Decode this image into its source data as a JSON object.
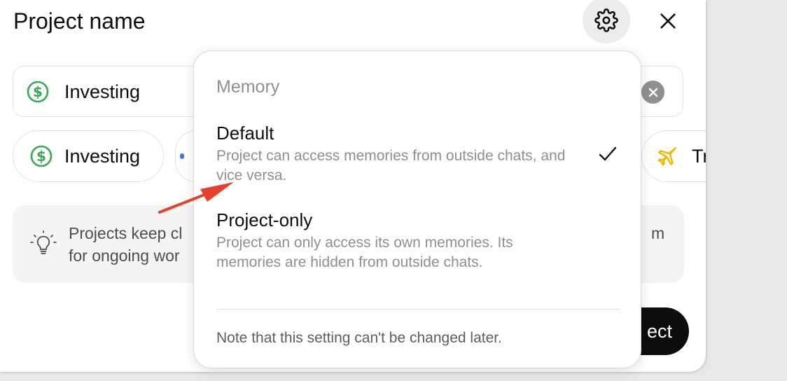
{
  "header": {
    "title": "Project name",
    "settings_icon": "gear-icon",
    "close_icon": "close-icon"
  },
  "name_field": {
    "value": "Investing",
    "icon": "dollar-circle-icon",
    "clear_icon": "clear-icon"
  },
  "suggestions": [
    {
      "label": "Investing",
      "icon": "dollar-circle-icon"
    },
    {
      "label": "",
      "icon": "partial-icon"
    },
    {
      "label": "Tr",
      "icon": "airplane-icon"
    }
  ],
  "info": {
    "line1_left": "Projects keep cl",
    "line1_right": "m",
    "line2_left": "for ongoing wor",
    "icon": "lightbulb-icon"
  },
  "create_button": {
    "label": "ect"
  },
  "memory_popover": {
    "heading": "Memory",
    "options": [
      {
        "title": "Default",
        "description": "Project can access memories from outside chats, and vice versa.",
        "selected": true
      },
      {
        "title": "Project-only",
        "description": "Project can only access its own memories. Its memories are hidden from outside chats.",
        "selected": false
      }
    ],
    "note": "Note that this setting can't be changed later."
  },
  "colors": {
    "accent_green": "#3aa757",
    "accent_yellow": "#f2b705",
    "annotation_red": "#e8412b",
    "primary_button": "#0d0d0d"
  }
}
